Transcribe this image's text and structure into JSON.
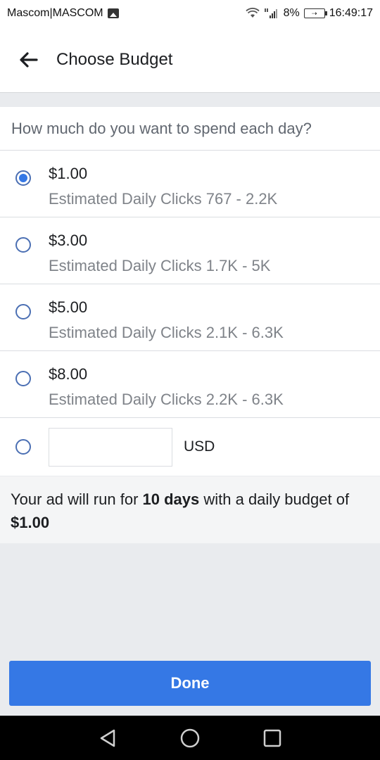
{
  "status_bar": {
    "carrier": "Mascom|MASCOM",
    "battery": "8%",
    "time": "16:49:17",
    "icons": [
      "image-icon",
      "wifi-icon",
      "signal-icon",
      "battery-icon"
    ]
  },
  "header": {
    "title": "Choose Budget",
    "back_icon": "arrow-left-icon"
  },
  "question": "How much do you want to spend each day?",
  "options": [
    {
      "amount": "$1.00",
      "estimate": "Estimated Daily Clicks 767 - 2.2K",
      "selected": true
    },
    {
      "amount": "$3.00",
      "estimate": "Estimated Daily Clicks 1.7K - 5K",
      "selected": false
    },
    {
      "amount": "$5.00",
      "estimate": "Estimated Daily Clicks 2.1K - 6.3K",
      "selected": false
    },
    {
      "amount": "$8.00",
      "estimate": "Estimated Daily Clicks 2.2K - 6.3K",
      "selected": false
    }
  ],
  "custom": {
    "value": "",
    "currency": "USD"
  },
  "summary": {
    "prefix": "Your ad will run for ",
    "days": "10 days",
    "middle": " with a daily budget of ",
    "budget": "$1.00"
  },
  "done_label": "Done",
  "colors": {
    "accent": "#3578e5",
    "background": "#e9ebee"
  }
}
